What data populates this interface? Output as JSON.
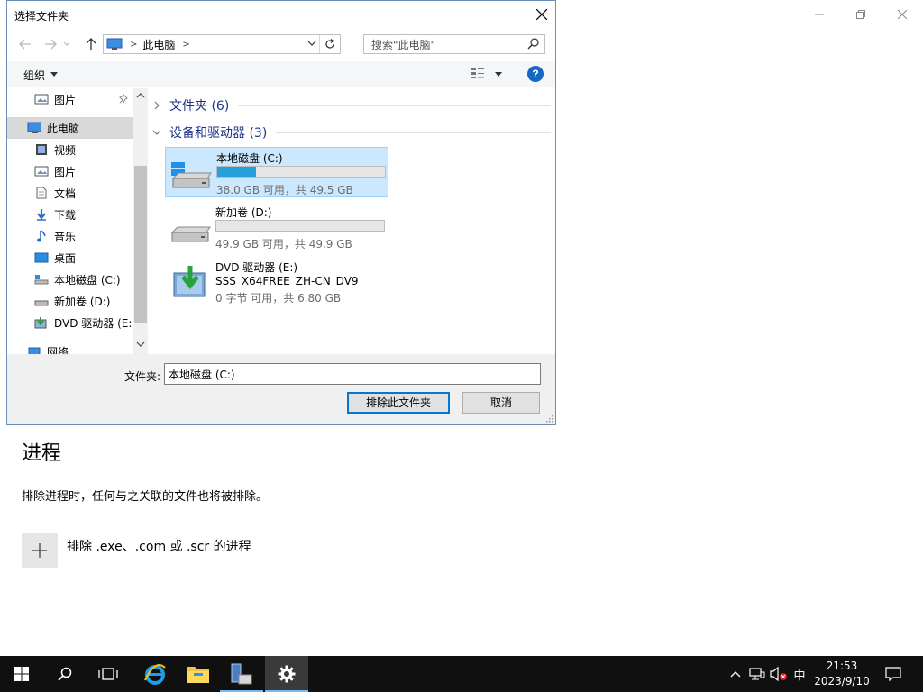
{
  "settings": {
    "heading": "进程",
    "description": "排除进程时，任何与之关联的文件也将被排除。",
    "add_label": "排除 .exe、.com 或 .scr 的进程"
  },
  "dialog": {
    "title": "选择文件夹",
    "address": {
      "segment": "此电脑"
    },
    "search_placeholder": "搜索\"此电脑\"",
    "toolbar": {
      "organize": "组织"
    },
    "nav": {
      "items": [
        {
          "label": "图片",
          "icon": "pictures-icon"
        },
        {
          "label": "此电脑",
          "icon": "computer-icon"
        },
        {
          "label": "视频",
          "icon": "video-icon"
        },
        {
          "label": "图片",
          "icon": "pictures-icon"
        },
        {
          "label": "文档",
          "icon": "document-icon"
        },
        {
          "label": "下载",
          "icon": "download-icon"
        },
        {
          "label": "音乐",
          "icon": "music-icon"
        },
        {
          "label": "桌面",
          "icon": "desktop-icon"
        },
        {
          "label": "本地磁盘 (C:)",
          "icon": "drive-icon"
        },
        {
          "label": "新加卷 (D:)",
          "icon": "drive-icon"
        },
        {
          "label": "DVD 驱动器 (E:",
          "icon": "dvd-icon"
        },
        {
          "label": "网络",
          "icon": "network-icon"
        }
      ]
    },
    "groups": {
      "folders": "文件夹 (6)",
      "devices": "设备和驱动器 (3)"
    },
    "drives": [
      {
        "name": "本地磁盘 (C:)",
        "info": "38.0 GB 可用，共 49.5 GB",
        "used": 0.232
      },
      {
        "name": "新加卷 (D:)",
        "info": "49.9 GB 可用，共 49.9 GB",
        "used": 0.0
      },
      {
        "name": "DVD 驱动器 (E:)",
        "label": "SSS_X64FREE_ZH-CN_DV9",
        "info": "0 字节 可用，共 6.80 GB"
      }
    ],
    "footer": {
      "folder_label": "文件夹:",
      "folder_value": "本地磁盘 (C:)",
      "exclude_button": "排除此文件夹",
      "cancel_button": "取消"
    }
  },
  "taskbar": {
    "ime": "中",
    "time": "21:53",
    "date": "2023/9/10"
  },
  "colors": {
    "accent": "#0078d7",
    "selection": "#cce8ff",
    "progress": "#26a0da",
    "taskbar": "#101010"
  }
}
